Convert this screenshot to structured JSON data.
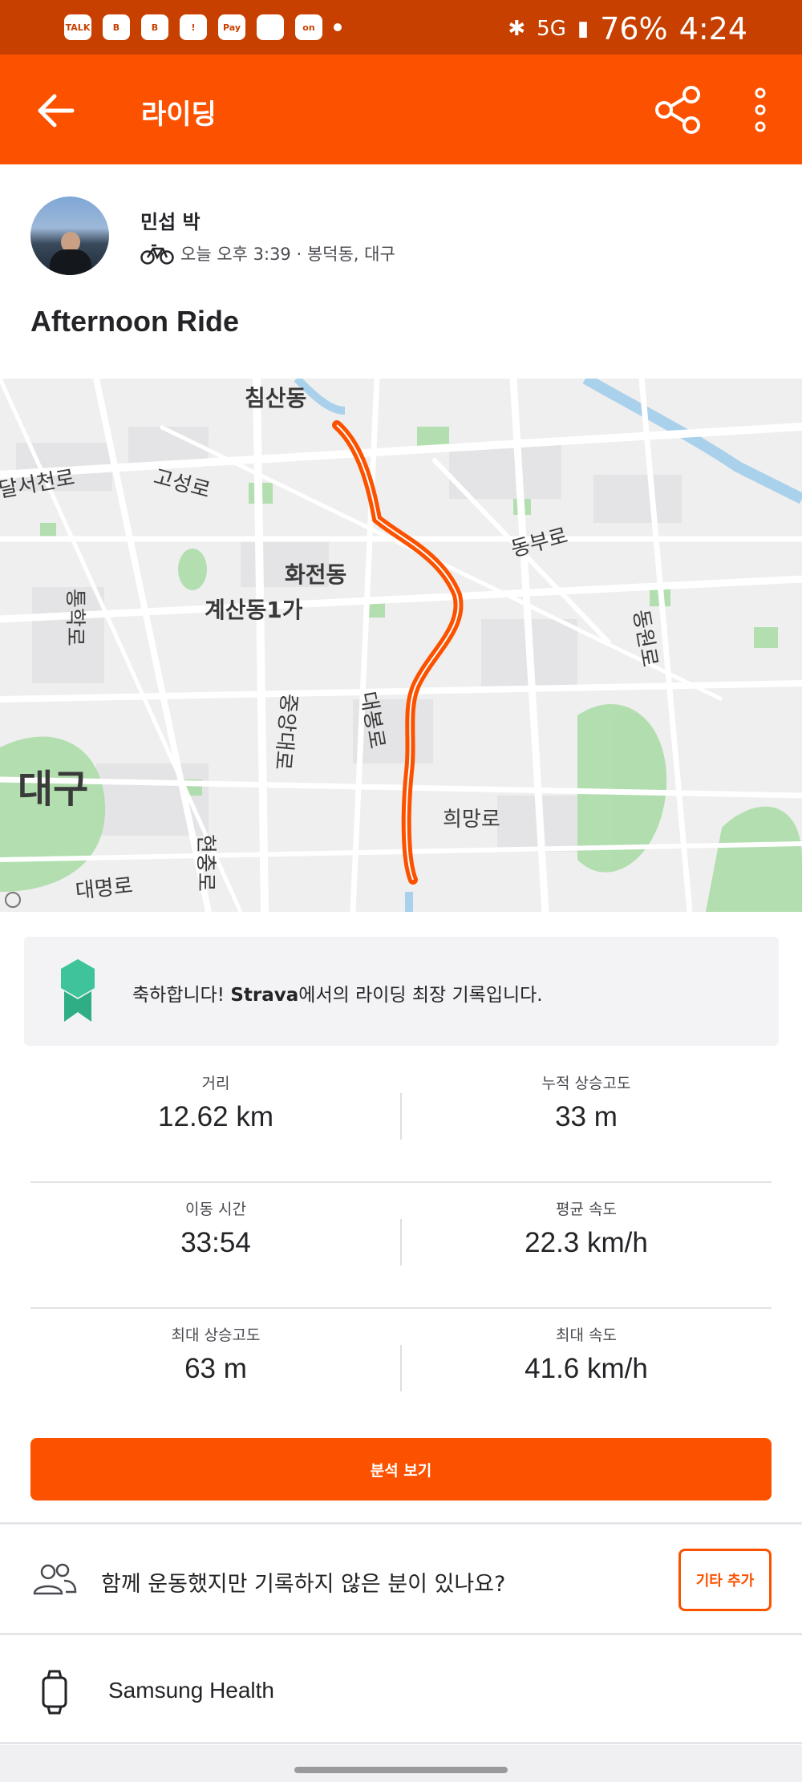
{
  "status_bar": {
    "notification_icons": [
      "TALK",
      "B",
      "B",
      "!",
      "Pay",
      "",
      "on"
    ],
    "battery": "76%",
    "time": "4:24",
    "network": "5G"
  },
  "app_bar": {
    "title": "라이딩",
    "back_icon": "arrow-left-icon",
    "share_icon": "share-icon",
    "more_icon": "more-vert-icon"
  },
  "activity": {
    "athlete_name": "민섭 박",
    "sport_icon": "bike-icon",
    "meta": "오늘 오후 3:39 · 봉덕동, 대구",
    "title": "Afternoon Ride"
  },
  "map": {
    "labels": [
      "침산동",
      "달서천로",
      "고성로",
      "동부로",
      "화전동",
      "계산동1가",
      "통학로",
      "동원로",
      "중앙대로",
      "대봉로",
      "대구",
      "희망로",
      "현충로",
      "대명로"
    ],
    "route_color": "#fc5200"
  },
  "achievement": {
    "icon": "medal-icon",
    "prefix": "축하합니다! ",
    "brand": "Strava",
    "suffix": "에서의 라이딩 최장 기록입니다."
  },
  "stats": [
    {
      "left_label": "거리",
      "left_value": "12.62 km",
      "right_label": "누적 상승고도",
      "right_value": "33 m"
    },
    {
      "left_label": "이동 시간",
      "left_value": "33:54",
      "right_label": "평균 속도",
      "right_value": "22.3 km/h"
    },
    {
      "left_label": "최대 상승고도",
      "left_value": "63 m",
      "right_label": "최대 속도",
      "right_value": "41.6 km/h"
    }
  ],
  "cta_label": "분석 보기",
  "together": {
    "text": "함께 운동했지만 기록하지 않은 분이 있나요?",
    "button": "기타 추가"
  },
  "device": {
    "name": "Samsung Health"
  },
  "colors": {
    "brand": "#fc5200",
    "status_bar": "#c74000"
  }
}
